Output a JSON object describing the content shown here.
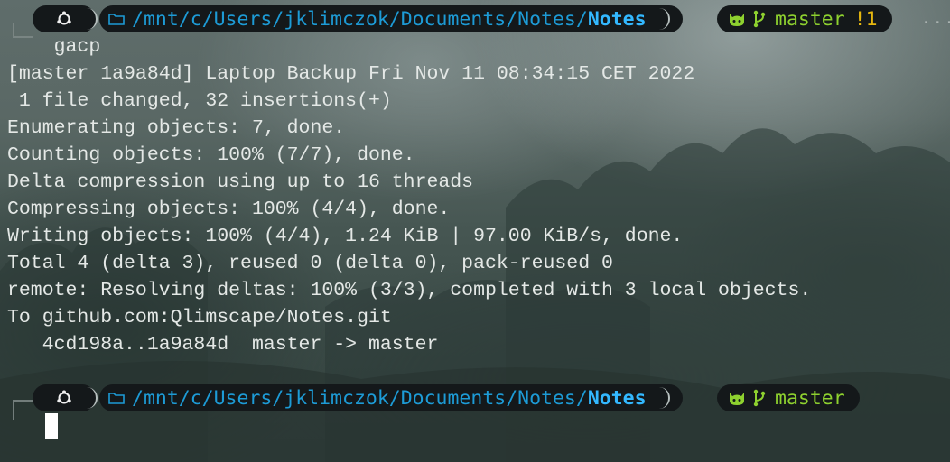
{
  "colors": {
    "pill_bg": "#14181a",
    "path_blue": "#1d9bd6",
    "path_leaf_blue": "#33b8ff",
    "branch_green": "#8ed12f",
    "status_yellow": "#e6b70f",
    "text": "#e4e8e6"
  },
  "prompt1": {
    "os_icon": "ubuntu-icon",
    "folder_icon": "folder-icon",
    "path": "/mnt/c/Users/jklimczok/Documents/Notes/",
    "path_leaf": "Notes",
    "git_icon": "github-cat-icon",
    "branch_icon": "git-branch-icon",
    "branch": "master",
    "status": "!1",
    "trailing": "···"
  },
  "command": "gacp",
  "output_lines": [
    "[master 1a9a84d] Laptop Backup Fri Nov 11 08:34:15 CET 2022",
    " 1 file changed, 32 insertions(+)",
    "Enumerating objects: 7, done.",
    "Counting objects: 100% (7/7), done.",
    "Delta compression using up to 16 threads",
    "Compressing objects: 100% (4/4), done.",
    "Writing objects: 100% (4/4), 1.24 KiB | 97.00 KiB/s, done.",
    "Total 4 (delta 3), reused 0 (delta 0), pack-reused 0",
    "remote: Resolving deltas: 100% (3/3), completed with 3 local objects.",
    "To github.com:Qlimscape/Notes.git",
    "   4cd198a..1a9a84d  master -> master"
  ],
  "prompt2": {
    "os_icon": "ubuntu-icon",
    "folder_icon": "folder-icon",
    "path": "/mnt/c/Users/jklimczok/Documents/Notes/",
    "path_leaf": "Notes",
    "git_icon": "github-cat-icon",
    "branch_icon": "git-branch-icon",
    "branch": "master"
  }
}
